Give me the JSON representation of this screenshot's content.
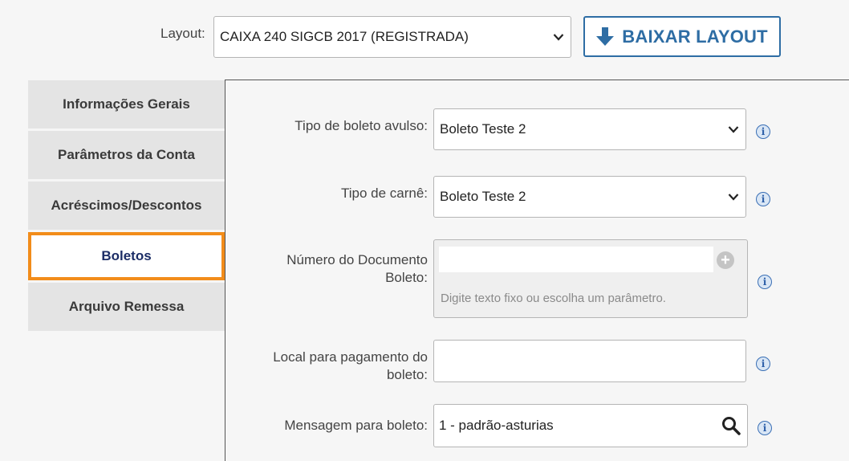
{
  "header": {
    "layout_label": "Layout:",
    "layout_selected": "CAIXA 240 SIGCB 2017 (REGISTRADA)",
    "download_button": "BAIXAR LAYOUT"
  },
  "sidebar": {
    "items": [
      {
        "label": "Informações Gerais",
        "active": false
      },
      {
        "label": "Parâmetros da Conta",
        "active": false
      },
      {
        "label": "Acréscimos/Descontos",
        "active": false
      },
      {
        "label": "Boletos",
        "active": true
      },
      {
        "label": "Arquivo Remessa",
        "active": false
      }
    ]
  },
  "form": {
    "tipo_boleto_avulso": {
      "label": "Tipo de boleto avulso:",
      "value": "Boleto Teste 2"
    },
    "tipo_carne": {
      "label": "Tipo de carnê:",
      "value": "Boleto Teste 2"
    },
    "numero_documento": {
      "label_line1": "Número do Documento",
      "label_line2": "Boleto:",
      "value": "",
      "hint": "Digite texto fixo ou escolha um parâmetro."
    },
    "local_pagamento": {
      "label_line1": "Local para pagamento do",
      "label_line2": "boleto:",
      "value": ""
    },
    "mensagem": {
      "label": "Mensagem para boleto:",
      "value": "1 - padrão-asturias"
    }
  },
  "colors": {
    "accent": "#2e6da4",
    "active_tab_border": "#f28c1a",
    "active_tab_text": "#1c2d66"
  },
  "icons": {
    "download": "arrow-down-icon",
    "info": "info-icon",
    "add": "plus-circle-icon",
    "search": "search-icon",
    "dropdown": "chevron-down-icon"
  }
}
